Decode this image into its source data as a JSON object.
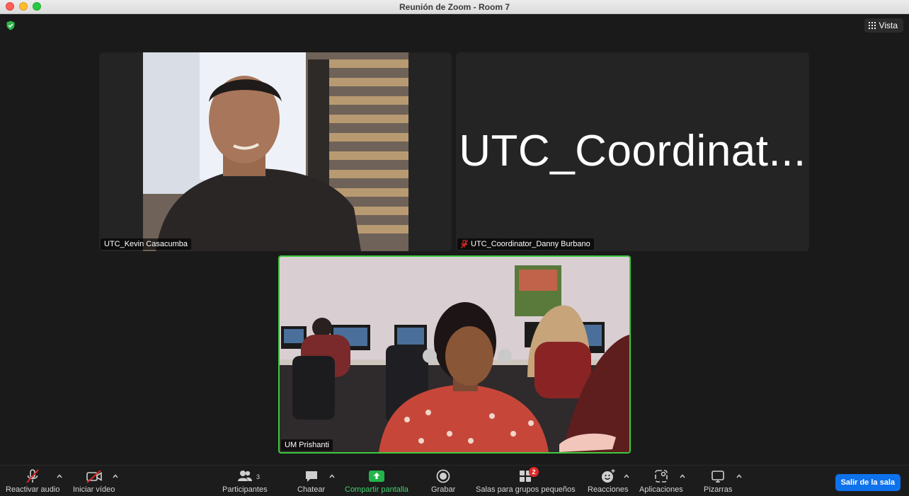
{
  "window": {
    "title": "Reunión de Zoom - Room 7"
  },
  "view_button": {
    "label": "Vista"
  },
  "participants": [
    {
      "name": "UTC_Kevin Casacumba"
    },
    {
      "name": "UTC_Coordinator_Danny Burbano",
      "display_text": "UTC_Coordinat...",
      "muted": true
    },
    {
      "name": "UM Prishanti",
      "active_speaker": true
    }
  ],
  "toolbar": {
    "audio_label": "Reactivar audio",
    "video_label": "Iniciar vídeo",
    "participants_label": "Participantes",
    "participants_count": "3",
    "chat_label": "Chatear",
    "share_label": "Compartir pantalla",
    "record_label": "Grabar",
    "breakout_label": "Salas para grupos pequeños",
    "breakout_badge": "2",
    "reactions_label": "Reacciones",
    "apps_label": "Aplicaciones",
    "whiteboards_label": "Pizarras",
    "leave_label": "Salir de la sala"
  },
  "colors": {
    "active_speaker_border": "#3ec93e",
    "share_green": "#23b54b",
    "leave_blue": "#0e72ed",
    "muted_red": "#e02828"
  }
}
